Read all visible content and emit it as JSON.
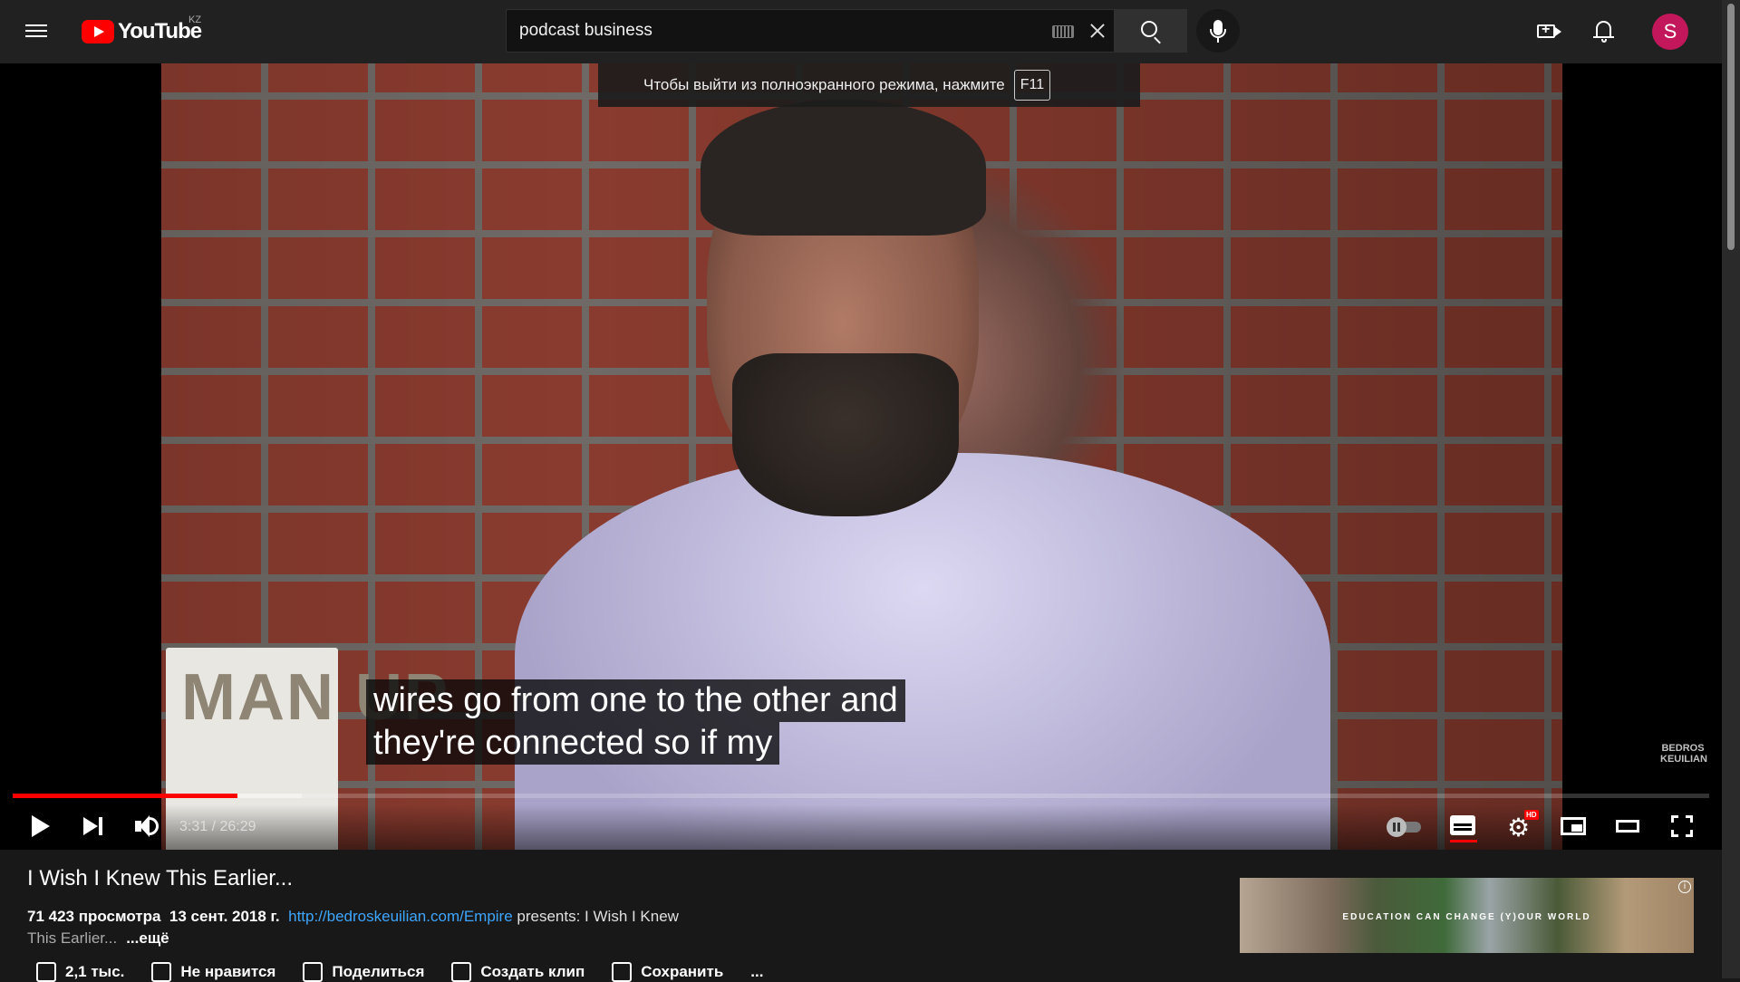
{
  "masthead": {
    "logo_text": "YouTube",
    "country_code": "KZ",
    "search": {
      "value": "podcast business"
    },
    "avatar_letter": "S",
    "icons": {
      "menu": "hamburger-menu-icon",
      "keyboard": "keyboard-icon",
      "clear": "close-icon",
      "search": "search-icon",
      "mic": "microphone-icon",
      "create": "video-create-icon",
      "notifications": "bell-icon"
    }
  },
  "player": {
    "fullscreen_notice": "Чтобы выйти из полноэкранного режима, нажмите",
    "fullscreen_key": "F11",
    "captions": [
      "wires go from one to the other and",
      "they're connected so if my"
    ],
    "book_text": "MAN UP",
    "watermark_line1": "BEDROS",
    "watermark_line2": "KEUILIAN",
    "time_current": "3:31",
    "time_duration": "26:29",
    "time_display": "3:31 / 26:29",
    "progress_played_fraction": 0.1325,
    "progress_buffered_fraction": 0.1705,
    "settings_badge": "HD",
    "accent_color": "#ff0000"
  },
  "video": {
    "title": "I Wish I Knew This Earlier...",
    "views": "71 423 просмотра",
    "date": "13 сент. 2018 г.",
    "link": "http://bedroskeuilian.com/Empire",
    "description_rest": " presents: I Wish I Knew",
    "description_line2": "This Earlier...",
    "more_label": "...ещё"
  },
  "actions": {
    "like": "2,1 тыс.",
    "dislike": "Не нравится",
    "share": "Поделиться",
    "clip": "Создать клип",
    "save": "Сохранить",
    "more": "..."
  },
  "ad": {
    "text": "EDUCATION CAN CHANGE (Y)OUR WORLD",
    "info": "i"
  }
}
